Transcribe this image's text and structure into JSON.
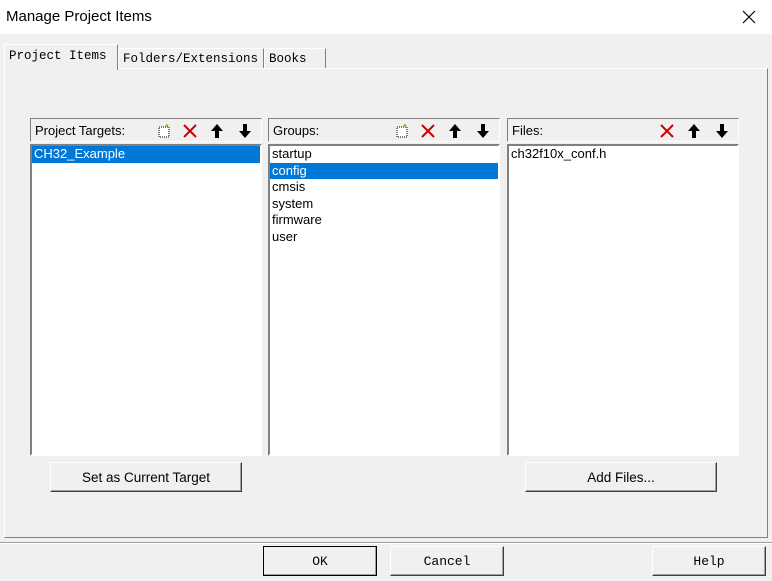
{
  "window": {
    "title": "Manage Project Items"
  },
  "tabs": [
    {
      "label": "Project Items",
      "active": true
    },
    {
      "label": "Folders/Extensions",
      "active": false
    },
    {
      "label": "Books",
      "active": false
    }
  ],
  "targets": {
    "label": "Project Targets:",
    "items": [
      "CH32_Example"
    ],
    "selected": 0,
    "button_label": "Set as Current Target"
  },
  "groups": {
    "label": "Groups:",
    "items": [
      "startup",
      "config",
      "cmsis",
      "system",
      "firmware",
      "user"
    ],
    "selected": 1
  },
  "files": {
    "label": "Files:",
    "items": [
      "ch32f10x_conf.h"
    ],
    "button_label": "Add Files..."
  },
  "footer": {
    "ok": "OK",
    "cancel": "Cancel",
    "help": "Help"
  },
  "icons": {
    "new": "new-item-icon",
    "delete": "delete-icon",
    "up": "arrow-up-icon",
    "down": "arrow-down-icon",
    "close": "close-icon"
  },
  "colors": {
    "selection": "#0078d7",
    "delete": "#cc0000"
  }
}
